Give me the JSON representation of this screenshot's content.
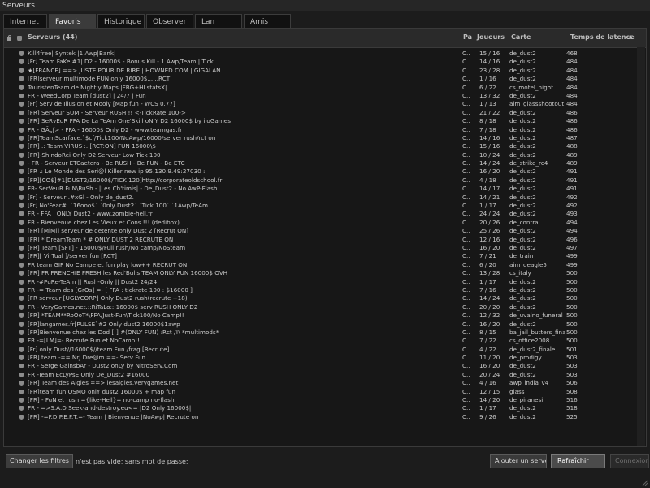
{
  "window": {
    "title": "Serveurs"
  },
  "tabs": [
    {
      "label": "Internet",
      "active": false
    },
    {
      "label": "Favoris",
      "active": true
    },
    {
      "label": "Historique",
      "active": false
    },
    {
      "label": "Observer",
      "active": false
    },
    {
      "label": "Lan",
      "active": false
    },
    {
      "label": "Amis",
      "active": false
    }
  ],
  "columns": {
    "servers": "Serveurs (44)",
    "pa": "Pa",
    "players": "Joueurs",
    "map": "Carte",
    "latency": "Temps de latence",
    "sort_indicator": "▲"
  },
  "servers": [
    {
      "name": "Kill4free| Syntek |1 Awp|Bank|",
      "pa": "C...",
      "players": "15 / 16",
      "map": "de_dust2",
      "latency": "468"
    },
    {
      "name": "[Fr] Team FaKe #1| D2 - 16000$ - Bonus Kill - 1 Awp/Team | Tick",
      "pa": "C...",
      "players": "14 / 16",
      "map": "de_dust2",
      "latency": "484"
    },
    {
      "name": "★[FRANCE] ==> JUSTE POUR DE RIRE | HOWNED.COM | GIGALAN",
      "pa": "C...",
      "players": "23 / 28",
      "map": "de_dust2",
      "latency": "484"
    },
    {
      "name": "[FR]serveur multimode FUN only 16000$......RCT",
      "pa": "C...",
      "players": "1 / 16",
      "map": "de_dust2",
      "latency": "484"
    },
    {
      "name": "TouristenTeam.de Nightly Maps |FBG+HLstatsX|",
      "pa": "C...",
      "players": "6 / 22",
      "map": "cs_motel_night",
      "latency": "484"
    },
    {
      "name": "FR - WeedCorp Team [dust2] | 24/7 | Fun",
      "pa": "C...",
      "players": "13 / 32",
      "map": "de_dust2",
      "latency": "484"
    },
    {
      "name": "[Fr] Serv de Illusion et Mooly [Map fun - WCS 0.77]",
      "pa": "C...",
      "players": "1 / 13",
      "map": "aim_glassshootout",
      "latency": "484"
    },
    {
      "name": "[FR] Serveur SUM - Serveur RUSH !! <-TickRate 100->",
      "pa": "C...",
      "players": "21 / 22",
      "map": "de_dust2",
      "latency": "486"
    },
    {
      "name": "[FR] SeRvEuR FFA De La TeAm One'Skill oNlY D2 16000$ by iloGames",
      "pa": "C...",
      "players": "8 / 18",
      "map": "de_dust2",
      "latency": "486"
    },
    {
      "name": "FR - GÃ„ƒ> - FFA - 16000$ Only D2 - www.teamgas.fr",
      "pa": "C...",
      "players": "7 / 18",
      "map": "de_dust2",
      "latency": "486"
    },
    {
      "name": "[FR]TeamScarface.`$cf/Tick100/NoAwp/16000/server rush/rct on",
      "pa": "C...",
      "players": "14 / 16",
      "map": "de_dust2",
      "latency": "487"
    },
    {
      "name": "[FR] .: Team VIRUS :. [RCT:ON] FUN 16000\\$",
      "pa": "C...",
      "players": "15 / 16",
      "map": "de_dust2",
      "latency": "488"
    },
    {
      "name": "[FR]-ShindoRei Only D2 Serveur Low Tick 100",
      "pa": "C...",
      "players": "10 / 24",
      "map": "de_dust2",
      "latency": "489"
    },
    {
      "name": "- FR - Serveur ETCaetera - Be RUSH - Be FUN - Be ETC",
      "pa": "C...",
      "players": "14 / 24",
      "map": "de_strike_rc4",
      "latency": "489"
    },
    {
      "name": "[FR .: Le Monde des Seri@l Killer new ip 95.130.9.49:27030 :.",
      "pa": "C...",
      "players": "16 / 20",
      "map": "de_dust2",
      "latency": "491"
    },
    {
      "name": "[FR][CO$]#1[DUST2/16000$/TICK 120]http://corporateoldschool.fr",
      "pa": "C...",
      "players": "4 / 18",
      "map": "de_dust2",
      "latency": "491"
    },
    {
      "name": "FR- SerVeuR FuN\\RuSh - |Les Ch'timis| - De_Dust2 - No AwP-Flash",
      "pa": "C...",
      "players": "14 / 17",
      "map": "de_dust2",
      "latency": "491"
    },
    {
      "name": "[Fr] - Serveur .#xGl - Only de_dust2.",
      "pa": "C...",
      "players": "14 / 21",
      "map": "de_dust2",
      "latency": "492"
    },
    {
      "name": "[Fr] No'Fear#. `16ooo$` `0nly Dust2` `Tick 100` `1Awp/TeAm",
      "pa": "C...",
      "players": "1 / 17",
      "map": "de_dust2",
      "latency": "492"
    },
    {
      "name": "FR - FFA | ONLY Dust2 - www.zombie-hell.fr",
      "pa": "C...",
      "players": "24 / 24",
      "map": "de_dust2",
      "latency": "493"
    },
    {
      "name": "FR - Bienvenue chez Les Vieux et Cons !!! (dedibox)",
      "pa": "C...",
      "players": "20 / 26",
      "map": "de_contra",
      "latency": "494"
    },
    {
      "name": "[FR] [MiMi] serveur de detente only Dust 2 [Recrut ON]",
      "pa": "C...",
      "players": "25 / 26",
      "map": "de_dust2",
      "latency": "494"
    },
    {
      "name": "[FR] * DreamTeam * # ONLY DUST 2 RECRUTE ON",
      "pa": "C...",
      "players": "12 / 16",
      "map": "de_dust2",
      "latency": "496"
    },
    {
      "name": "[FR] Team [SFT] - 16000$/Full rush/No camp/NoSteam",
      "pa": "C...",
      "players": "16 / 20",
      "map": "de_dust2",
      "latency": "497"
    },
    {
      "name": "[FR][ VirTual ]/server fun [RCT]",
      "pa": "C...",
      "players": "7 / 21",
      "map": "de_train",
      "latency": "499"
    },
    {
      "name": "FR team GIF No Campe et fun play low++ RECRUT ON",
      "pa": "C...",
      "players": "6 / 20",
      "map": "aim_deagle5",
      "latency": "499"
    },
    {
      "name": "[FR] FR FRENCHIE FRESH les Red'Bulls TEAM ONLY FUN 16000$ OVH",
      "pa": "C...",
      "players": "13 / 28",
      "map": "cs_italy",
      "latency": "500"
    },
    {
      "name": "FR -#PuRe-TeAm || Rush-Only || Dust2 24/24",
      "pa": "C...",
      "players": "1 / 17",
      "map": "de_dust2",
      "latency": "500"
    },
    {
      "name": "FR -= Team des [GrOs] =- [ FFA : tickrate 100 : $16000 ]",
      "pa": "C...",
      "players": "7 / 16",
      "map": "de_dust2",
      "latency": "500"
    },
    {
      "name": "[FR serveur [UGLYCORP] Only Dust2 rush(recrute +18)",
      "pa": "C...",
      "players": "14 / 24",
      "map": "de_dust2",
      "latency": "500"
    },
    {
      "name": "FR - VeryGames.net.::RiTaLo::.16000$ serv RUSH ONLY D2",
      "pa": "C...",
      "players": "20 / 20",
      "map": "de_dust2",
      "latency": "500"
    },
    {
      "name": "[FR] *TEAM**RoOoT*\\FFA/Just-Fun\\Tick100/No Camp!!",
      "pa": "C...",
      "players": "12 / 32",
      "map": "de_uvalno_funeral",
      "latency": "500"
    },
    {
      "name": "[FR]langames.fr[PULSE`#2 Only dust2 16000$1awp",
      "pa": "C...",
      "players": "16 / 20",
      "map": "de_dust2",
      "latency": "500"
    },
    {
      "name": "[FR]Bienvenue chez les Dod [!] #(ONLY FUN) :Rct /!\\ *multimods*",
      "pa": "C...",
      "players": "8 / 15",
      "map": "ba_jail_butters_final",
      "latency": "500"
    },
    {
      "name": "FR -=[LM]=- Recrute Fun et NoCamp!!",
      "pa": "C...",
      "players": "7 / 22",
      "map": "cs_office2008",
      "latency": "500"
    },
    {
      "name": "[Fr] only Dust//16000$//team Fun /frag [Recrute]",
      "pa": "C...",
      "players": "4 / 22",
      "map": "de_dust2_finale",
      "latency": "501"
    },
    {
      "name": "[FR] team -== NrJ Dre@m ==- Serv Fun",
      "pa": "C...",
      "players": "11 / 20",
      "map": "de_prodigy",
      "latency": "503"
    },
    {
      "name": "FR - Serge GainsbAr - Dust2 onLy by NitroServ.Com",
      "pa": "C...",
      "players": "16 / 20",
      "map": "de_dust2",
      "latency": "503"
    },
    {
      "name": "FR -Team EcLyPsE Only De_Dust2 #16000",
      "pa": "C...",
      "players": "20 / 24",
      "map": "de_dust2",
      "latency": "503"
    },
    {
      "name": "[FR] Team des Aigles ==> lesaigles.verygames.net",
      "pa": "C...",
      "players": "4 / 16",
      "map": "awp_india_v4",
      "latency": "506"
    },
    {
      "name": "[FR]team fun OSMO onlY dust2 16000$ + map fun",
      "pa": "C...",
      "players": "12 / 15",
      "map": "glass",
      "latency": "508"
    },
    {
      "name": "[FR] - FuN et rush ={like-Hell}= no-camp no-flash",
      "pa": "C...",
      "players": "14 / 20",
      "map": "de_piranesi",
      "latency": "516"
    },
    {
      "name": "FR - =>S.A.D Seek-and-destroy.eu<= |D2 Only 16000$|",
      "pa": "C...",
      "players": "1 / 17",
      "map": "de_dust2",
      "latency": "518"
    },
    {
      "name": "[FR] -=F.D.P.E.F.T.=- Team | Bienvenue |NoAwp| Recrute on",
      "pa": "C...",
      "players": "9 / 26",
      "map": "de_dust2",
      "latency": "525"
    }
  ],
  "footer": {
    "change_filters": "Changer les filtres",
    "filter_status": "n'est pas vide; sans mot de passe;",
    "add_server": "Ajouter un serve",
    "refresh": "Rafraîchir",
    "connect": "Connexion"
  },
  "colors": {
    "background": "#1c1c1c",
    "panel": "#171717",
    "text": "#c9c9c9",
    "accent_tab": "#3b3b3b"
  }
}
